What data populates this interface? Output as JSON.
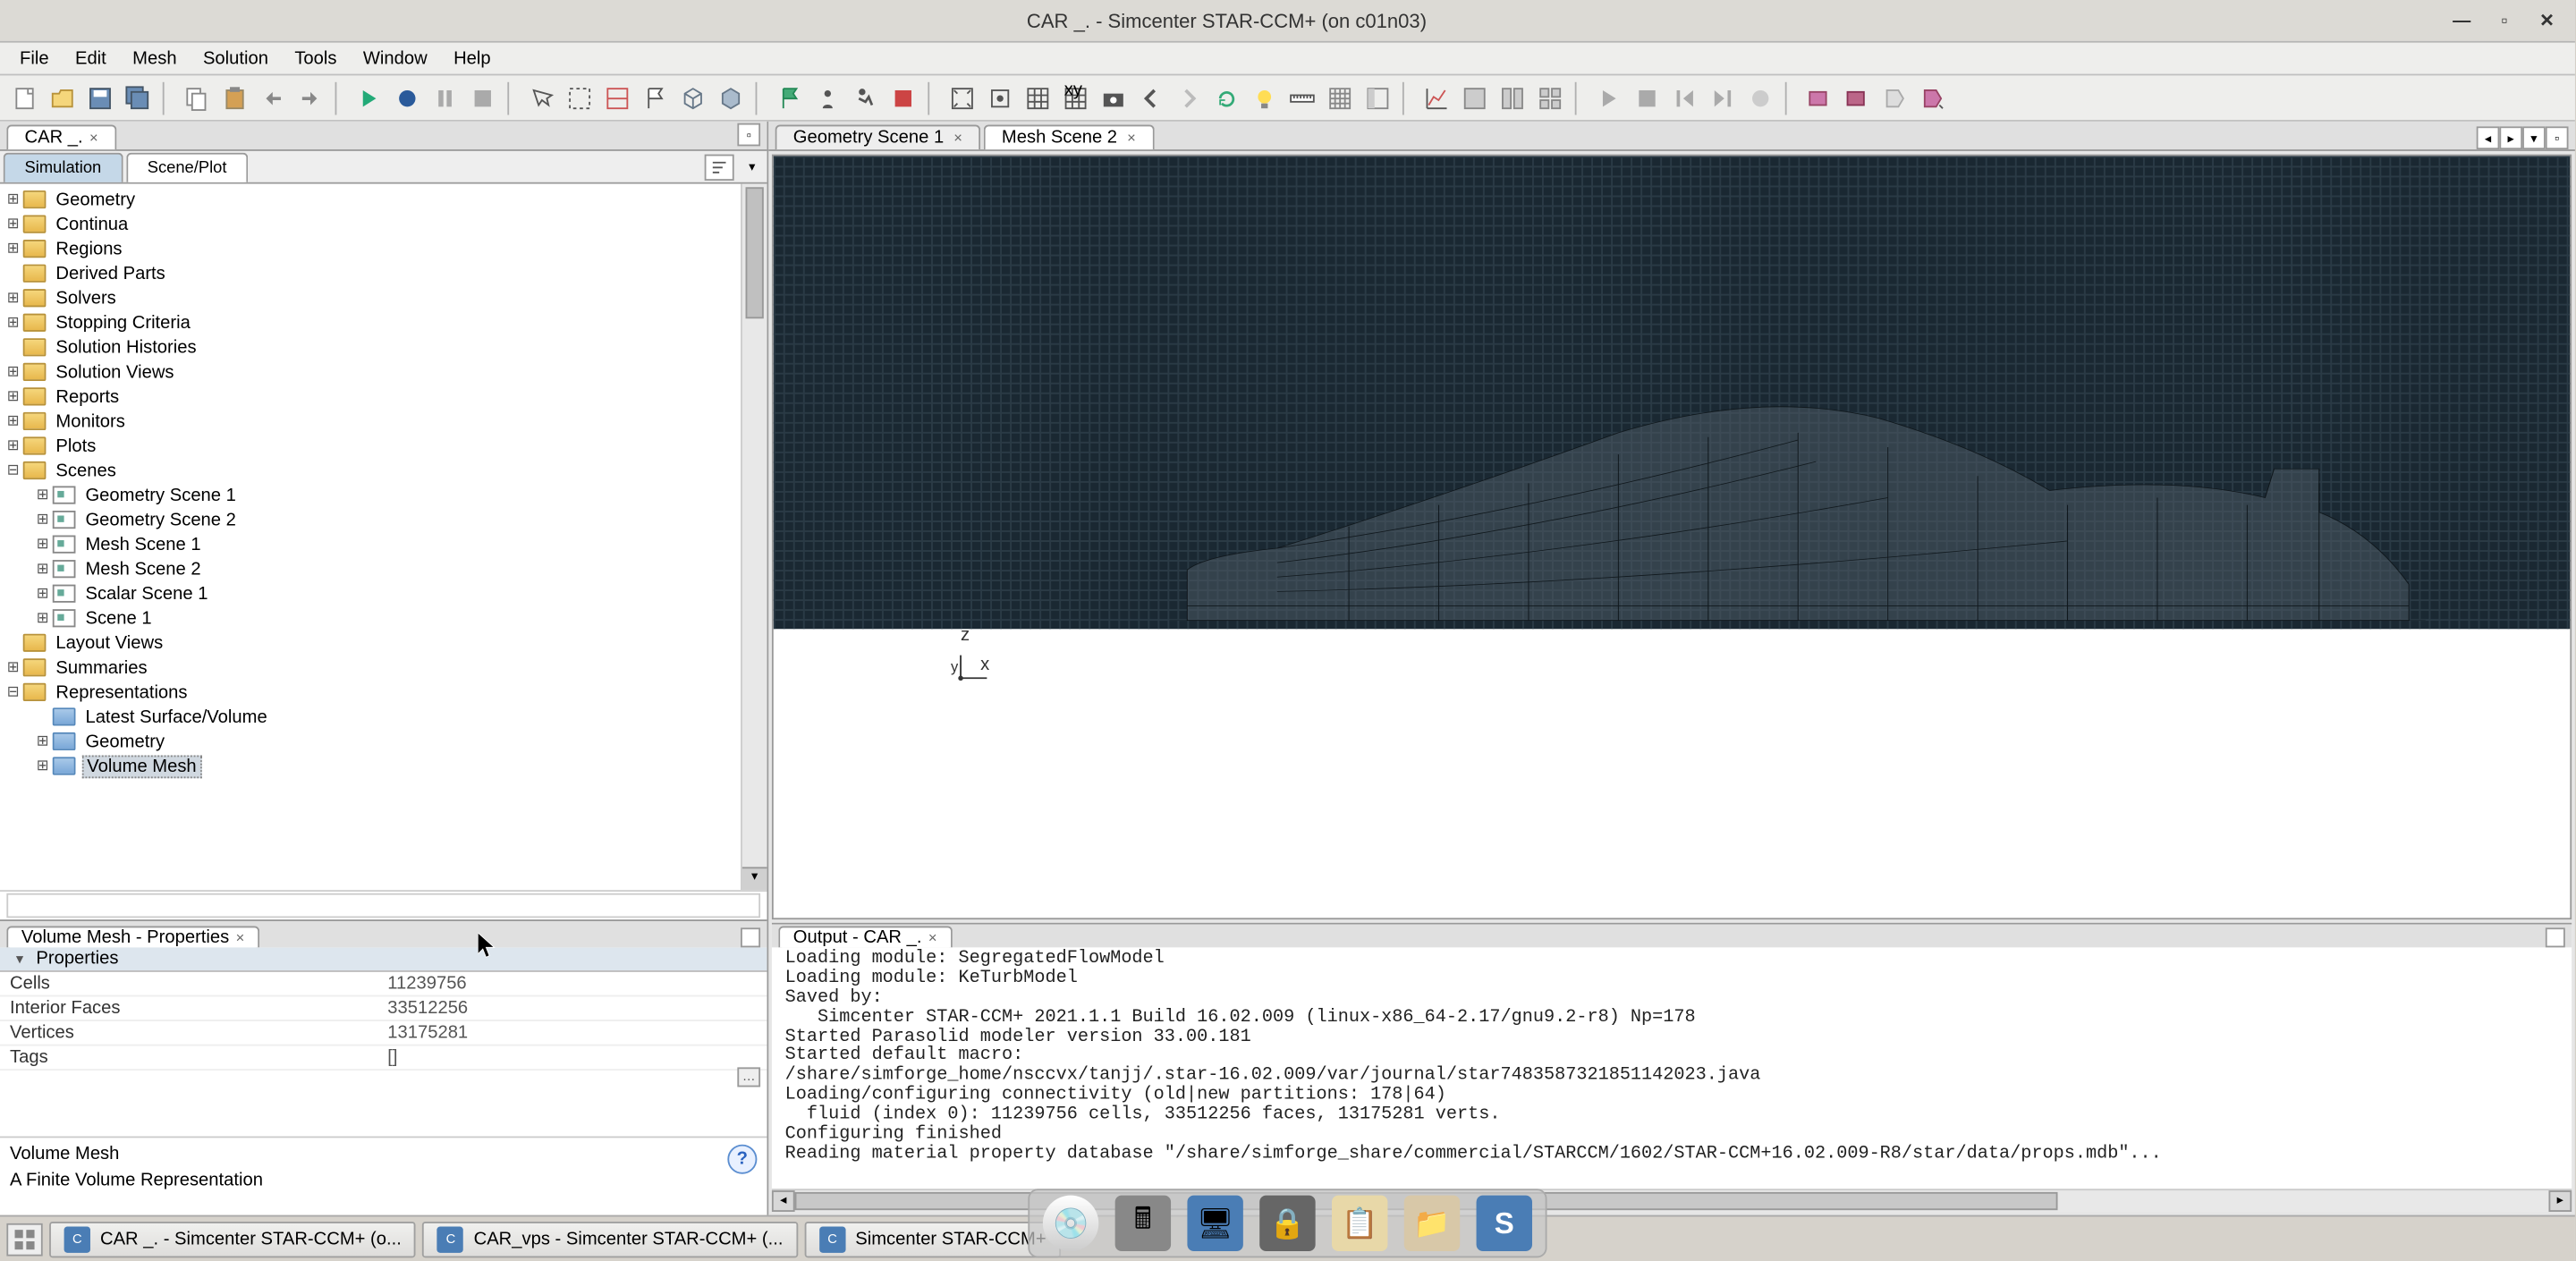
{
  "window": {
    "title": "CAR _. - Simcenter STAR-CCM+ (on c01n03)"
  },
  "menu": {
    "items": [
      "File",
      "Edit",
      "Mesh",
      "Solution",
      "Tools",
      "Window",
      "Help"
    ]
  },
  "doc_tab": {
    "label": "CAR _.",
    "close": "×"
  },
  "sim_tabs": {
    "simulation": "Simulation",
    "sceneplot": "Scene/Plot"
  },
  "tree": [
    {
      "d": 0,
      "tw": "⊞",
      "icon": "folder",
      "label": "Geometry"
    },
    {
      "d": 0,
      "tw": "⊞",
      "icon": "folder",
      "label": "Continua"
    },
    {
      "d": 0,
      "tw": "⊞",
      "icon": "folder",
      "label": "Regions"
    },
    {
      "d": 0,
      "tw": "",
      "icon": "folder",
      "label": "Derived Parts"
    },
    {
      "d": 0,
      "tw": "⊞",
      "icon": "folder",
      "label": "Solvers"
    },
    {
      "d": 0,
      "tw": "⊞",
      "icon": "folder",
      "label": "Stopping Criteria"
    },
    {
      "d": 0,
      "tw": "",
      "icon": "folder",
      "label": "Solution Histories"
    },
    {
      "d": 0,
      "tw": "⊞",
      "icon": "folder",
      "label": "Solution Views"
    },
    {
      "d": 0,
      "tw": "⊞",
      "icon": "folder",
      "label": "Reports"
    },
    {
      "d": 0,
      "tw": "⊞",
      "icon": "folder",
      "label": "Monitors"
    },
    {
      "d": 0,
      "tw": "⊞",
      "icon": "folder",
      "label": "Plots"
    },
    {
      "d": 0,
      "tw": "⊟",
      "icon": "folder",
      "label": "Scenes"
    },
    {
      "d": 1,
      "tw": "⊞",
      "icon": "scene",
      "label": "Geometry Scene 1"
    },
    {
      "d": 1,
      "tw": "⊞",
      "icon": "scene",
      "label": "Geometry Scene 2"
    },
    {
      "d": 1,
      "tw": "⊞",
      "icon": "scene",
      "label": "Mesh Scene 1"
    },
    {
      "d": 1,
      "tw": "⊞",
      "icon": "scene",
      "label": "Mesh Scene 2"
    },
    {
      "d": 1,
      "tw": "⊞",
      "icon": "scene",
      "label": "Scalar Scene 1"
    },
    {
      "d": 1,
      "tw": "⊞",
      "icon": "scene",
      "label": "Scene 1"
    },
    {
      "d": 0,
      "tw": "",
      "icon": "folder",
      "label": "Layout Views"
    },
    {
      "d": 0,
      "tw": "⊞",
      "icon": "folder",
      "label": "Summaries"
    },
    {
      "d": 0,
      "tw": "⊟",
      "icon": "folder",
      "label": "Representations"
    },
    {
      "d": 1,
      "tw": "",
      "icon": "folder-blue",
      "label": "Latest Surface/Volume"
    },
    {
      "d": 1,
      "tw": "⊞",
      "icon": "folder-blue",
      "label": "Geometry"
    },
    {
      "d": 1,
      "tw": "⊞",
      "icon": "folder-blue",
      "label": "Volume Mesh",
      "selected": true
    }
  ],
  "properties": {
    "panel_title": "Volume Mesh - Properties",
    "section": "Properties",
    "rows": [
      {
        "k": "Cells",
        "v": "11239756"
      },
      {
        "k": "Interior Faces",
        "v": "33512256"
      },
      {
        "k": "Vertices",
        "v": "13175281"
      },
      {
        "k": "Tags",
        "v": "[]",
        "btn": true
      }
    ],
    "desc_name": "Volume Mesh",
    "desc_text": "A Finite Volume Representation"
  },
  "scene_tabs": [
    {
      "label": "Geometry Scene 1",
      "active": false
    },
    {
      "label": "Mesh Scene 2",
      "active": true
    }
  ],
  "axis": {
    "z": "z",
    "y": "y",
    "x": "x"
  },
  "output": {
    "tab": "Output - CAR _.",
    "lines": [
      "Loading module: SegregatedFlowModel",
      "Loading module: KeTurbModel",
      "Saved by:",
      "   Simcenter STAR-CCM+ 2021.1.1 Build 16.02.009 (linux-x86_64-2.17/gnu9.2-r8) Np=178",
      "Started Parasolid modeler version 33.00.181",
      "Started default macro:",
      "/share/simforge_home/nsccvx/tanjj/.star-16.02.009/var/journal/star7483587321851142023.java",
      "Loading/configuring connectivity (old|new partitions: 178|64)",
      "  fluid (index 0): 11239756 cells, 33512256 faces, 13175281 verts.",
      "Configuring finished",
      "Reading material property database \"/share/simforge_share/commercial/STARCCM/1602/STAR-CCM+16.02.009-R8/star/data/props.mdb\"..."
    ]
  },
  "taskbar": [
    {
      "label": "CAR _. - Simcenter STAR-CCM+ (o..."
    },
    {
      "label": "CAR_vps - Simcenter STAR-CCM+ (..."
    },
    {
      "label": "Simcenter STAR-CCM+"
    }
  ]
}
